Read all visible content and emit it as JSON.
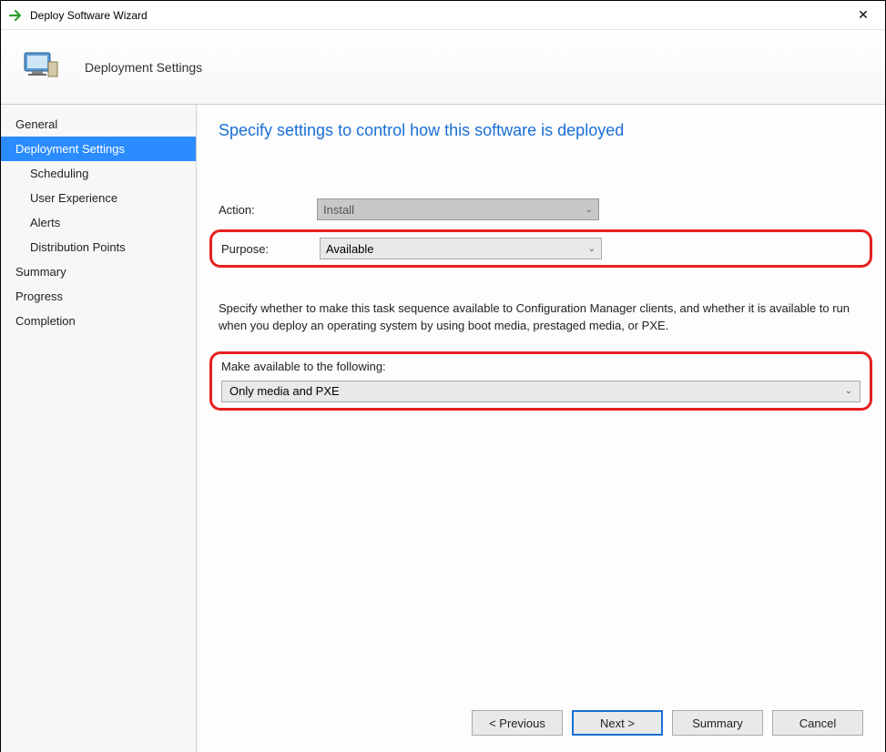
{
  "titlebar": {
    "title": "Deploy Software Wizard"
  },
  "header": {
    "title": "Deployment Settings"
  },
  "sidebar": {
    "items": [
      {
        "label": "General",
        "sub": false,
        "selected": false
      },
      {
        "label": "Deployment Settings",
        "sub": false,
        "selected": true
      },
      {
        "label": "Scheduling",
        "sub": true,
        "selected": false
      },
      {
        "label": "User Experience",
        "sub": true,
        "selected": false
      },
      {
        "label": "Alerts",
        "sub": true,
        "selected": false
      },
      {
        "label": "Distribution Points",
        "sub": true,
        "selected": false
      },
      {
        "label": "Summary",
        "sub": false,
        "selected": false
      },
      {
        "label": "Progress",
        "sub": false,
        "selected": false
      },
      {
        "label": "Completion",
        "sub": false,
        "selected": false
      }
    ]
  },
  "main": {
    "heading": "Specify settings to control how this software is deployed",
    "action_label": "Action:",
    "action_value": "Install",
    "purpose_label": "Purpose:",
    "purpose_value": "Available",
    "help_text": "Specify whether to make this task sequence available to Configuration Manager clients, and whether it is available to run when you deploy an operating system by using boot media, prestaged media, or PXE.",
    "make_available_label": "Make available to the following:",
    "make_available_value": "Only media and PXE"
  },
  "buttons": {
    "previous": "< Previous",
    "next": "Next >",
    "summary": "Summary",
    "cancel": "Cancel"
  }
}
